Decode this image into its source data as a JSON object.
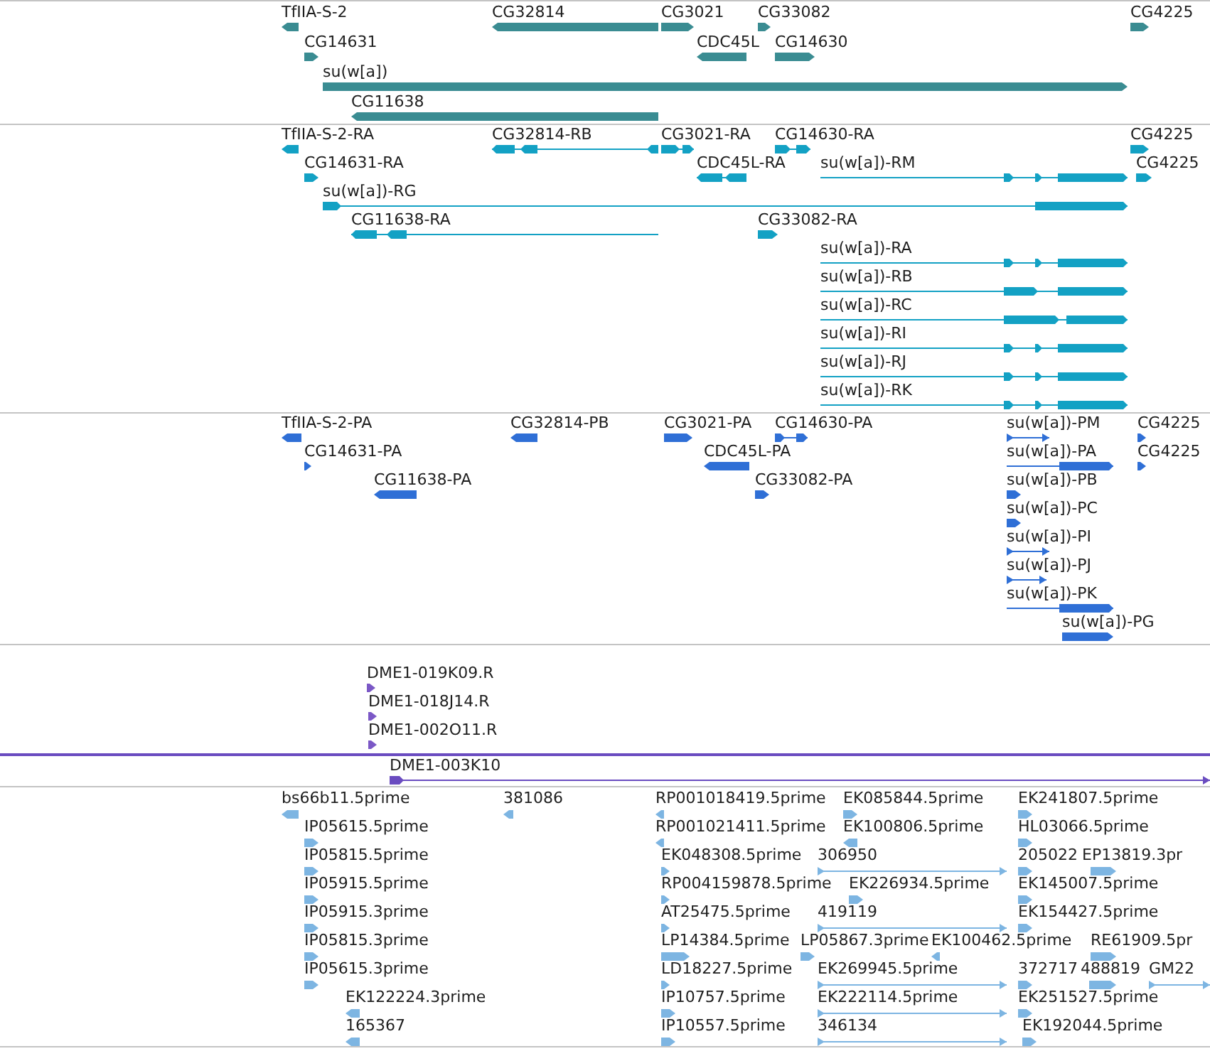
{
  "tracks": [
    {
      "color": "#3a8c92",
      "features": [
        {
          "label": "TfIIA-S-2",
          "reverse": true
        },
        {
          "label": "CG32814",
          "reverse": true
        },
        {
          "label": "CG3021",
          "reverse": false
        },
        {
          "label": "CG33082",
          "reverse": false
        },
        {
          "label": "CG4225",
          "reverse": false
        },
        {
          "label": "CG14631",
          "reverse": false
        },
        {
          "label": "CDC45L",
          "reverse": true
        },
        {
          "label": "CG14630",
          "reverse": false
        },
        {
          "label": "su(w[a])",
          "reverse": false
        },
        {
          "label": "CG11638",
          "reverse": true
        }
      ]
    },
    {
      "color": "#13a1c4",
      "features": [
        {
          "label": "TfIIA-S-2-RA",
          "reverse": true
        },
        {
          "label": "CG32814-RB",
          "reverse": true
        },
        {
          "label": "CG3021-RA",
          "reverse": false
        },
        {
          "label": "CG14630-RA",
          "reverse": false
        },
        {
          "label": "CG4225",
          "reverse": false
        },
        {
          "label": "CG14631-RA",
          "reverse": false
        },
        {
          "label": "CDC45L-RA",
          "reverse": true
        },
        {
          "label": "su(w[a])-RM",
          "reverse": false
        },
        {
          "label": "CG4225",
          "reverse": false
        },
        {
          "label": "su(w[a])-RG",
          "reverse": false
        },
        {
          "label": "CG11638-RA",
          "reverse": true
        },
        {
          "label": "CG33082-RA",
          "reverse": false
        },
        {
          "label": "su(w[a])-RA",
          "reverse": false
        },
        {
          "label": "su(w[a])-RB",
          "reverse": false
        },
        {
          "label": "su(w[a])-RC",
          "reverse": false
        },
        {
          "label": "su(w[a])-RI",
          "reverse": false
        },
        {
          "label": "su(w[a])-RJ",
          "reverse": false
        },
        {
          "label": "su(w[a])-RK",
          "reverse": false
        }
      ]
    },
    {
      "color": "#2f6fd6",
      "features": [
        {
          "label": "TfIIA-S-2-PA",
          "reverse": true
        },
        {
          "label": "CG32814-PB",
          "reverse": true
        },
        {
          "label": "CG3021-PA",
          "reverse": false
        },
        {
          "label": "CG14630-PA",
          "reverse": false
        },
        {
          "label": "su(w[a])-PM",
          "reverse": false
        },
        {
          "label": "CG4225",
          "reverse": false
        },
        {
          "label": "CG14631-PA",
          "reverse": false
        },
        {
          "label": "CDC45L-PA",
          "reverse": true
        },
        {
          "label": "su(w[a])-PA",
          "reverse": false
        },
        {
          "label": "CG4225",
          "reverse": false
        },
        {
          "label": "CG11638-PA",
          "reverse": true
        },
        {
          "label": "CG33082-PA",
          "reverse": false
        },
        {
          "label": "su(w[a])-PB",
          "reverse": false
        },
        {
          "label": "su(w[a])-PC",
          "reverse": false
        },
        {
          "label": "su(w[a])-PI",
          "reverse": false
        },
        {
          "label": "su(w[a])-PJ",
          "reverse": false
        },
        {
          "label": "su(w[a])-PK",
          "reverse": false
        },
        {
          "label": "su(w[a])-PG",
          "reverse": false
        }
      ]
    },
    {
      "color": "#7b58c6",
      "features": [
        {
          "label": "DME1-019K09.R",
          "reverse": false
        },
        {
          "label": "DME1-018J14.R",
          "reverse": false
        },
        {
          "label": "DME1-002O11.R",
          "reverse": false
        }
      ]
    },
    {
      "color": "#6a4cc0",
      "features": [
        {
          "label": "DME1-003K10",
          "reverse": false
        }
      ]
    },
    {
      "color": "#7db5e2",
      "features": [
        {
          "label": "bs66b11.5prime",
          "reverse": true
        },
        {
          "label": "381086",
          "reverse": true
        },
        {
          "label": "RP001018419.5prime",
          "reverse": true
        },
        {
          "label": "EK085844.5prime",
          "reverse": false
        },
        {
          "label": "EK241807.5prime",
          "reverse": false
        },
        {
          "label": "IP05615.5prime",
          "reverse": false
        },
        {
          "label": "RP001021411.5prime",
          "reverse": true
        },
        {
          "label": "EK100806.5prime",
          "reverse": true
        },
        {
          "label": "HL03066.5prime",
          "reverse": false
        },
        {
          "label": "IP05815.5prime",
          "reverse": false
        },
        {
          "label": "EK048308.5prime",
          "reverse": false
        },
        {
          "label": "306950",
          "reverse": false
        },
        {
          "label": "205022",
          "reverse": false
        },
        {
          "label": "EP13819.3pr",
          "reverse": false
        },
        {
          "label": "IP05915.5prime",
          "reverse": false
        },
        {
          "label": "RP004159878.5prime",
          "reverse": false
        },
        {
          "label": "EK226934.5prime",
          "reverse": false
        },
        {
          "label": "EK145007.5prime",
          "reverse": false
        },
        {
          "label": "IP05915.3prime",
          "reverse": false
        },
        {
          "label": "AT25475.5prime",
          "reverse": false
        },
        {
          "label": "419119",
          "reverse": false
        },
        {
          "label": "EK154427.5prime",
          "reverse": false
        },
        {
          "label": "IP05815.3prime",
          "reverse": false
        },
        {
          "label": "LP14384.5prime",
          "reverse": false
        },
        {
          "label": "LP05867.3prime",
          "reverse": false
        },
        {
          "label": "EK100462.5prime",
          "reverse": true
        },
        {
          "label": "RE61909.5pr",
          "reverse": false
        },
        {
          "label": "IP05615.3prime",
          "reverse": false
        },
        {
          "label": "LD18227.5prime",
          "reverse": false
        },
        {
          "label": "EK269945.5prime",
          "reverse": false
        },
        {
          "label": "372717",
          "reverse": false
        },
        {
          "label": "488819",
          "reverse": false
        },
        {
          "label": "GM22",
          "reverse": false
        },
        {
          "label": "EK122224.3prime",
          "reverse": true
        },
        {
          "label": "IP10757.5prime",
          "reverse": false
        },
        {
          "label": "EK222114.5prime",
          "reverse": false
        },
        {
          "label": "EK251527.5prime",
          "reverse": false
        },
        {
          "label": "165367",
          "reverse": true
        },
        {
          "label": "IP10557.5prime",
          "reverse": false
        },
        {
          "label": "346134",
          "reverse": false
        },
        {
          "label": "EK192044.5prime",
          "reverse": false
        }
      ]
    }
  ]
}
